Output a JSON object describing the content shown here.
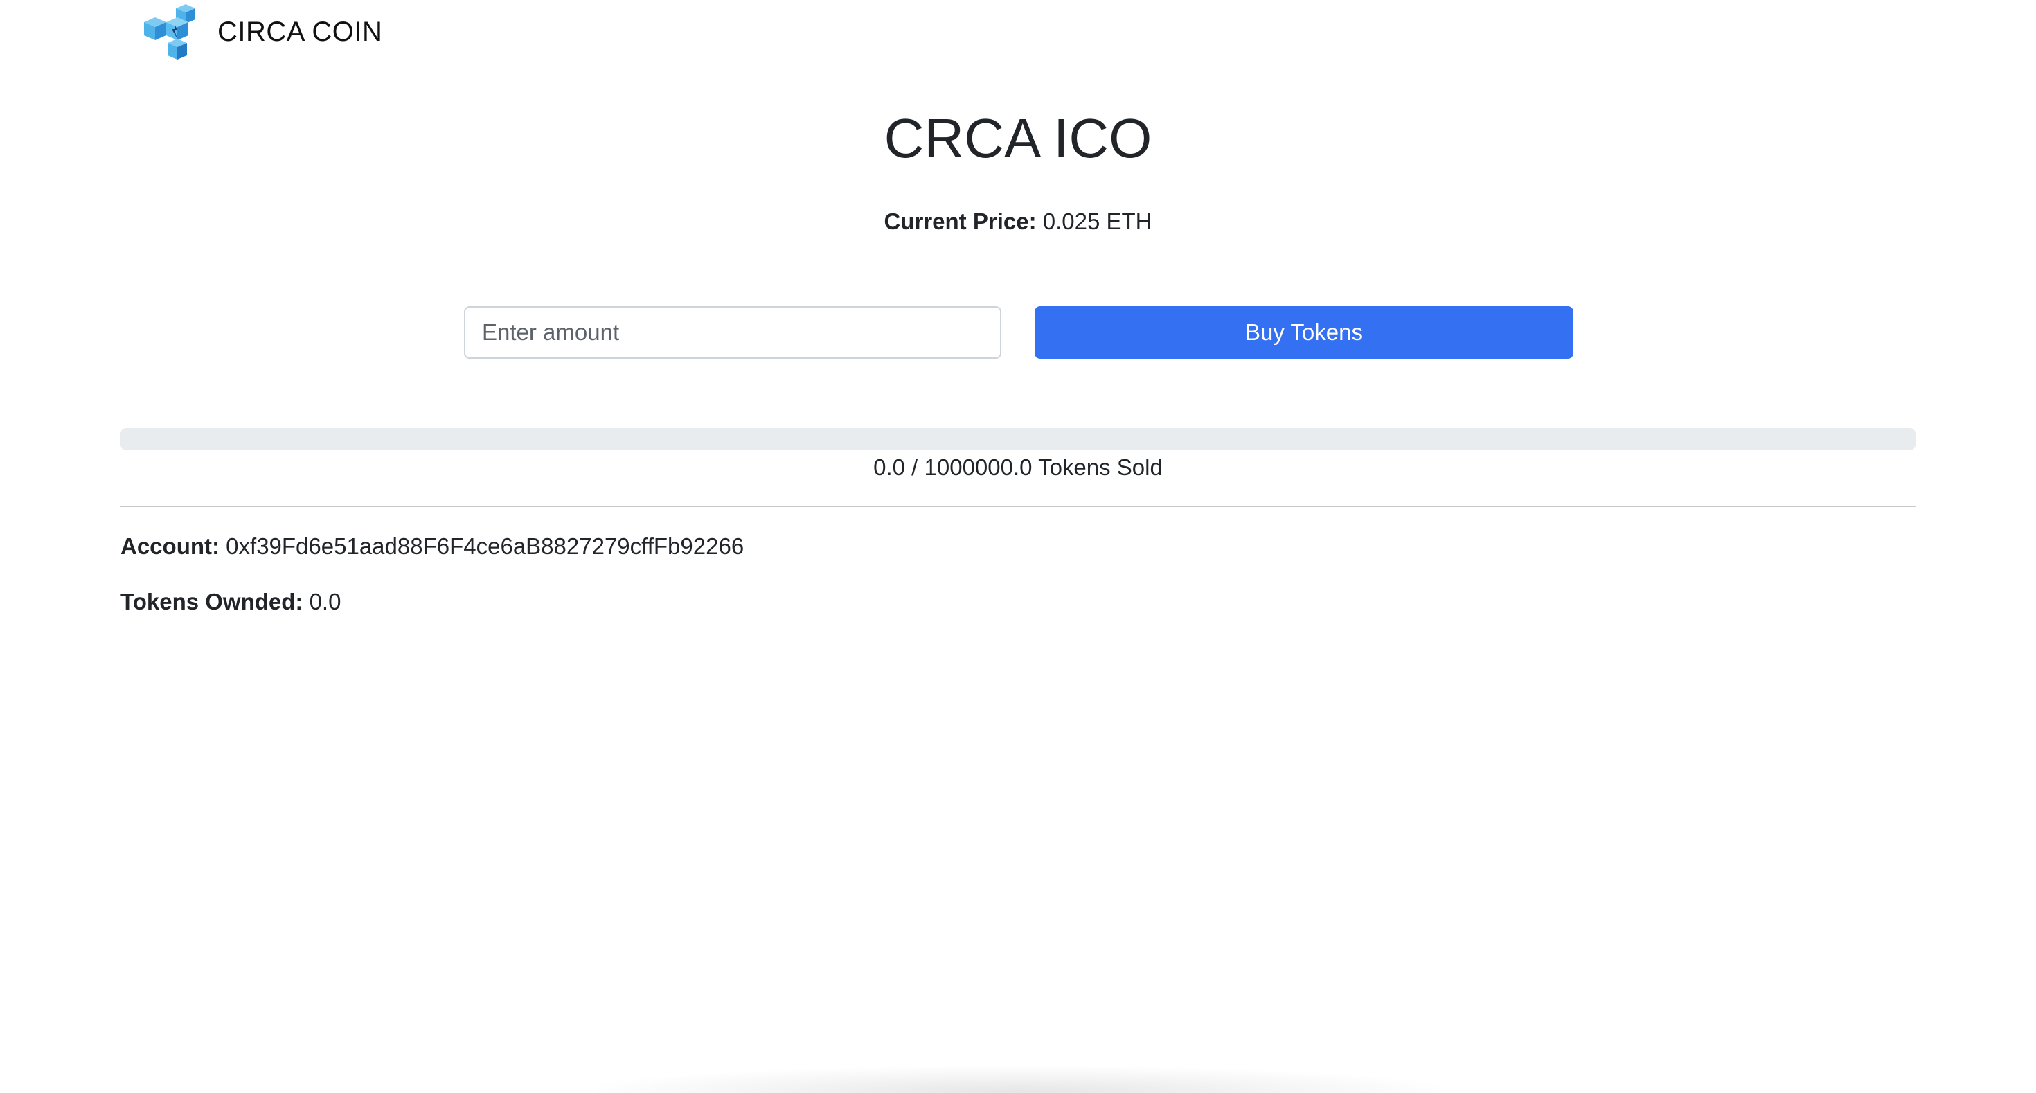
{
  "navbar": {
    "brand_name": "CIRCA COIN",
    "logo_icon": "cube-logo-icon",
    "logo_colors": [
      "#4fb3ea",
      "#2e8fd6",
      "#7dcbf2"
    ]
  },
  "main": {
    "title": "CRCA ICO",
    "price_label": "Current Price:",
    "price_value": "0.025 ETH"
  },
  "purchase_form": {
    "amount_placeholder": "Enter amount",
    "amount_value": "",
    "buy_label": "Buy Tokens",
    "buy_color": "#3370f2"
  },
  "progress": {
    "sold": 0.0,
    "total": 1000000.0,
    "fraction": 0.0,
    "text": "0.0 / 1000000.0 Tokens Sold"
  },
  "account": {
    "label": "Account:",
    "address": "0xf39Fd6e51aad88F6F4ce6aB8827279cffFb92266"
  },
  "tokens": {
    "label": "Tokens Ownded:",
    "value": "0.0"
  }
}
